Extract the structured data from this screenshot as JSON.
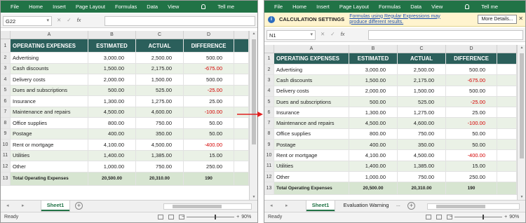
{
  "ribbon": {
    "tabs": [
      "File",
      "Home",
      "Insert",
      "Page Layout",
      "Formulas",
      "Data",
      "View"
    ],
    "tell_me": "Tell me"
  },
  "left": {
    "namebox": "G22"
  },
  "right": {
    "namebox": "N1"
  },
  "formula_icons": {
    "cancel": "✕",
    "enter": "✓",
    "fx": "fx"
  },
  "infobar": {
    "title": "CALCULATION SETTINGS",
    "message": "Formulas using Regular Expressions may produce different results.",
    "button": "More Details...",
    "close": "✕"
  },
  "columns": [
    "A",
    "B",
    "C",
    "D"
  ],
  "headers": [
    "OPERATING EXPENSES",
    "ESTIMATED",
    "ACTUAL",
    "DIFFERENCE"
  ],
  "rows": [
    {
      "num": "2",
      "label": "Advertising",
      "est": "3,000.00",
      "act": "2,500.00",
      "diff": "500.00",
      "neg": false
    },
    {
      "num": "3",
      "label": "Cash discounts",
      "est": "1,500.00",
      "act": "2,175.00",
      "diff": "-675.00",
      "neg": true
    },
    {
      "num": "4",
      "label": "Delivery costs",
      "est": "2,000.00",
      "act": "1,500.00",
      "diff": "500.00",
      "neg": false
    },
    {
      "num": "5",
      "label": "Dues and subscriptions",
      "est": "500.00",
      "act": "525.00",
      "diff": "-25.00",
      "neg": true
    },
    {
      "num": "6",
      "label": "Insurance",
      "est": "1,300.00",
      "act": "1,275.00",
      "diff": "25.00",
      "neg": false
    },
    {
      "num": "7",
      "label": "Maintenance and repairs",
      "est": "4,500.00",
      "act": "4,600.00",
      "diff": "-100.00",
      "neg": true
    },
    {
      "num": "8",
      "label": "Office supplies",
      "est": "800.00",
      "act": "750.00",
      "diff": "50.00",
      "neg": false
    },
    {
      "num": "9",
      "label": "Postage",
      "est": "400.00",
      "act": "350.00",
      "diff": "50.00",
      "neg": false
    },
    {
      "num": "10",
      "label": "Rent or mortgage",
      "est": "4,100.00",
      "act": "4,500.00",
      "diff": "-400.00",
      "neg": true
    },
    {
      "num": "11",
      "label": "Utilities",
      "est": "1,400.00",
      "act": "1,385.00",
      "diff": "15.00",
      "neg": false
    },
    {
      "num": "12",
      "label": "Other",
      "est": "1,000.00",
      "act": "750.00",
      "diff": "250.00",
      "neg": false
    }
  ],
  "header_row_num": "1",
  "total": {
    "num": "13",
    "label": "Total Operating Expenses",
    "est": "20,500.00",
    "act": "20,310.00",
    "diff": "190"
  },
  "left_sheets": [
    "Sheet1"
  ],
  "right_sheets": [
    "Sheet1",
    "Evaluation Warning"
  ],
  "more_sheets": "...",
  "status": {
    "ready": "Ready",
    "zoom": "90%",
    "zoom_minus": "−",
    "zoom_plus": "+"
  },
  "colors": {
    "excel_green": "#217346",
    "header_fill": "#2b5f5b",
    "band_fill": "#eaf1e6",
    "total_fill": "#d7e5d1",
    "negative": "#d40000",
    "info_bar": "#fff4ce",
    "arrow": "#e02020"
  }
}
